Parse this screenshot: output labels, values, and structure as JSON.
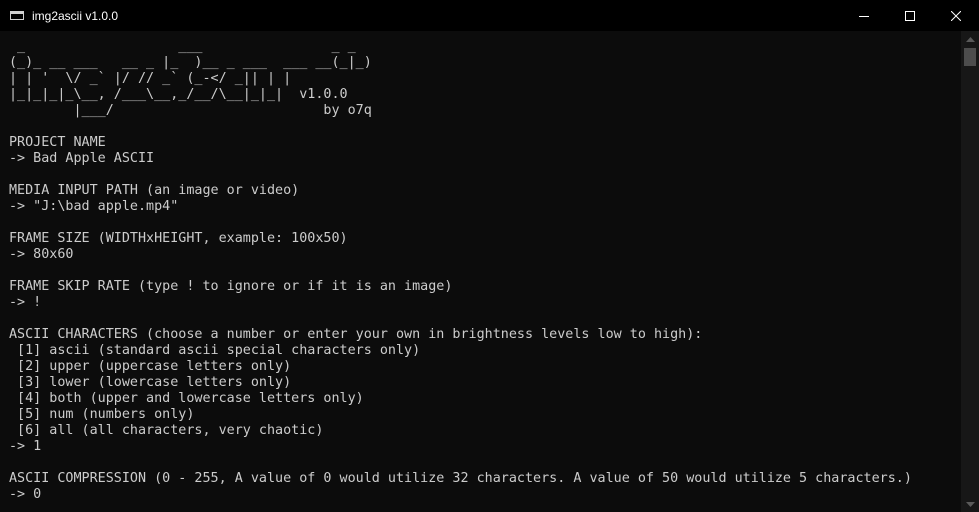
{
  "window": {
    "title": "img2ascii v1.0.0",
    "icon": "console-app-icon",
    "controls": [
      "minimize-icon",
      "maximize-icon",
      "close-icon"
    ]
  },
  "banner": [
    " _                   ___                _ _ ",
    "(_)_ __ ___   __ _ |_  )__ _ ___  ___ __(_|_)",
    "| | '  \\/ _` |/ // _` (_-</ _|| | |",
    "|_|_|_|_\\__, /___\\__,_/__/\\__|_|_|  v1.0.0",
    "        |___/                          by o7q"
  ],
  "console": {
    "lines": [
      "",
      "PROJECT NAME",
      "-> Bad Apple ASCII",
      "",
      "MEDIA INPUT PATH (an image or video)",
      "-> \"J:\\bad apple.mp4\"",
      "",
      "FRAME SIZE (WIDTHxHEIGHT, example: 100x50)",
      "-> 80x60",
      "",
      "FRAME SKIP RATE (type ! to ignore or if it is an image)",
      "-> !",
      "",
      "ASCII CHARACTERS (choose a number or enter your own in brightness levels low to high):",
      " [1] ascii (standard ascii special characters only)",
      " [2] upper (uppercase letters only)",
      " [3] lower (lowercase letters only)",
      " [4] both (upper and lowercase letters only)",
      " [5] num (numbers only)",
      " [6] all (all characters, very chaotic)",
      "-> 1",
      "",
      "ASCII COMPRESSION (0 - 255, A value of 0 would utilize 32 characters. A value of 50 would utilize 5 characters.)",
      "-> 0"
    ]
  },
  "scrollbar": {
    "position": 0.0,
    "icons": [
      "scroll-up-arrow-icon",
      "scroll-down-arrow-icon"
    ]
  },
  "colors": {
    "background": "#0c0c0c",
    "titlebar": "#000000",
    "text": "#cccccc"
  }
}
